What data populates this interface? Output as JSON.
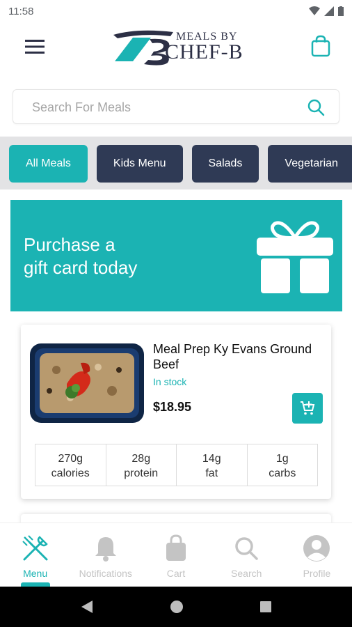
{
  "status_bar": {
    "time": "11:58"
  },
  "header": {
    "logo_small_text": "MEALS BY",
    "logo_main_text": "CHEF-B"
  },
  "search": {
    "placeholder": "Search For Meals"
  },
  "categories": [
    {
      "label": "All Meals",
      "active": true
    },
    {
      "label": "Kids Menu",
      "active": false
    },
    {
      "label": "Salads",
      "active": false
    },
    {
      "label": "Vegetarian",
      "active": false
    }
  ],
  "banner": {
    "line1": "Purchase a",
    "line2": "gift card today"
  },
  "meal": {
    "name": "Meal Prep Ky Evans Ground Beef",
    "stock": "In stock",
    "price": "$18.95",
    "nutrition": [
      {
        "value": "270g",
        "label": "calories"
      },
      {
        "value": "28g",
        "label": "protein"
      },
      {
        "value": "14g",
        "label": "fat"
      },
      {
        "value": "1g",
        "label": "carbs"
      }
    ]
  },
  "bottom_nav": [
    {
      "label": "Menu",
      "icon": "utensils-icon",
      "active": true
    },
    {
      "label": "Notifications",
      "icon": "bell-icon",
      "active": false
    },
    {
      "label": "Cart",
      "icon": "shopping-bag-icon",
      "active": false
    },
    {
      "label": "Search",
      "icon": "search-icon",
      "active": false
    },
    {
      "label": "Profile",
      "icon": "user-icon",
      "active": false
    }
  ],
  "colors": {
    "accent": "#1bb3b3",
    "chip_dark": "#2f3a55",
    "inactive_nav": "#c4c4c4"
  }
}
